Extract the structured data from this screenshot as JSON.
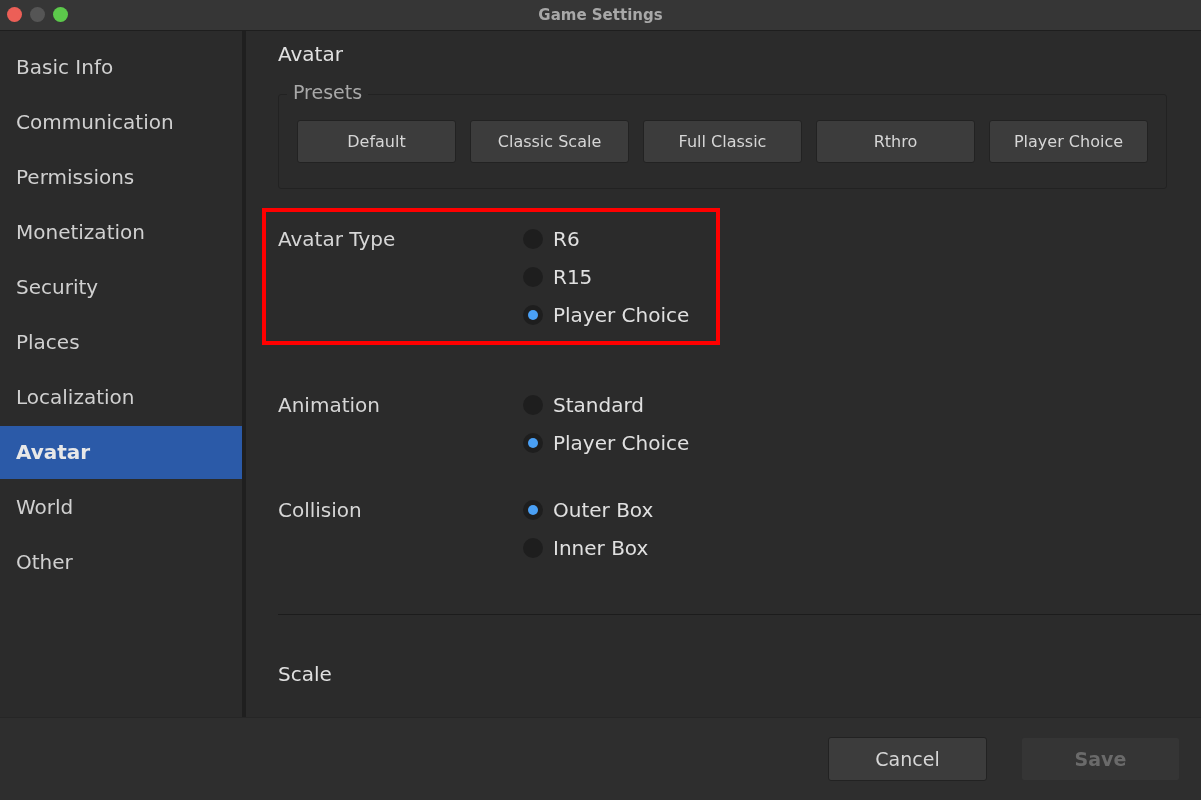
{
  "window": {
    "title": "Game Settings"
  },
  "sidebar": {
    "items": [
      {
        "label": "Basic Info",
        "selected": false
      },
      {
        "label": "Communication",
        "selected": false
      },
      {
        "label": "Permissions",
        "selected": false
      },
      {
        "label": "Monetization",
        "selected": false
      },
      {
        "label": "Security",
        "selected": false
      },
      {
        "label": "Places",
        "selected": false
      },
      {
        "label": "Localization",
        "selected": false
      },
      {
        "label": "Avatar",
        "selected": true
      },
      {
        "label": "World",
        "selected": false
      },
      {
        "label": "Other",
        "selected": false
      }
    ]
  },
  "content": {
    "heading": "Avatar",
    "presets": {
      "legend": "Presets",
      "buttons": [
        "Default",
        "Classic Scale",
        "Full Classic",
        "Rthro",
        "Player Choice"
      ]
    },
    "groups": [
      {
        "label": "Avatar Type",
        "highlighted": true,
        "options": [
          {
            "label": "R6",
            "selected": false
          },
          {
            "label": "R15",
            "selected": false
          },
          {
            "label": "Player Choice",
            "selected": true
          }
        ]
      },
      {
        "label": "Animation",
        "highlighted": false,
        "options": [
          {
            "label": "Standard",
            "selected": false
          },
          {
            "label": "Player Choice",
            "selected": true
          }
        ]
      },
      {
        "label": "Collision",
        "highlighted": false,
        "options": [
          {
            "label": "Outer Box",
            "selected": true
          },
          {
            "label": "Inner Box",
            "selected": false
          }
        ]
      }
    ],
    "section": "Scale"
  },
  "footer": {
    "buttons": [
      {
        "label": "Cancel",
        "disabled": false
      },
      {
        "label": "Save",
        "disabled": true
      }
    ]
  }
}
